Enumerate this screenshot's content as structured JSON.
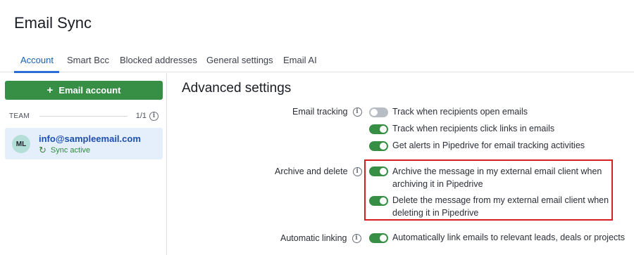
{
  "page": {
    "title": "Email Sync"
  },
  "tabs": [
    {
      "label": "Account",
      "active": true
    },
    {
      "label": "Smart Bcc",
      "active": false
    },
    {
      "label": "Blocked addresses",
      "active": false
    },
    {
      "label": "General settings",
      "active": false
    },
    {
      "label": "Email AI",
      "active": false
    }
  ],
  "sidebar": {
    "add_button": {
      "label": "Email account",
      "icon": "plus-icon"
    },
    "team": {
      "label": "TEAM",
      "count": "1/1"
    },
    "account": {
      "initials": "ML",
      "email": "info@sampleemail.com",
      "status": "Sync active",
      "status_icon": "sync-icon"
    }
  },
  "advanced": {
    "title": "Advanced settings",
    "email_tracking": {
      "label": "Email tracking",
      "options": [
        {
          "text": "Track when recipients open emails",
          "enabled": false
        },
        {
          "text": "Track when recipients click links in emails",
          "enabled": true
        },
        {
          "text": "Get alerts in Pipedrive for email tracking activities",
          "enabled": true
        }
      ]
    },
    "archive_delete": {
      "label": "Archive and delete",
      "options": [
        {
          "line1": "Archive the message in my external email client when",
          "line2": "archiving it in Pipedrive",
          "enabled": true
        },
        {
          "line1": "Delete the message from my external email client when",
          "line2": "deleting it in Pipedrive",
          "enabled": true
        }
      ]
    },
    "auto_linking": {
      "label": "Automatic linking",
      "options": [
        {
          "text": "Automatically link emails to relevant leads, deals or projects",
          "enabled": true
        }
      ]
    }
  },
  "colors": {
    "accent_green": "#368f44",
    "link_blue": "#1c4fb0",
    "highlight_red": "#d42020",
    "selected_card": "#e5effc"
  }
}
